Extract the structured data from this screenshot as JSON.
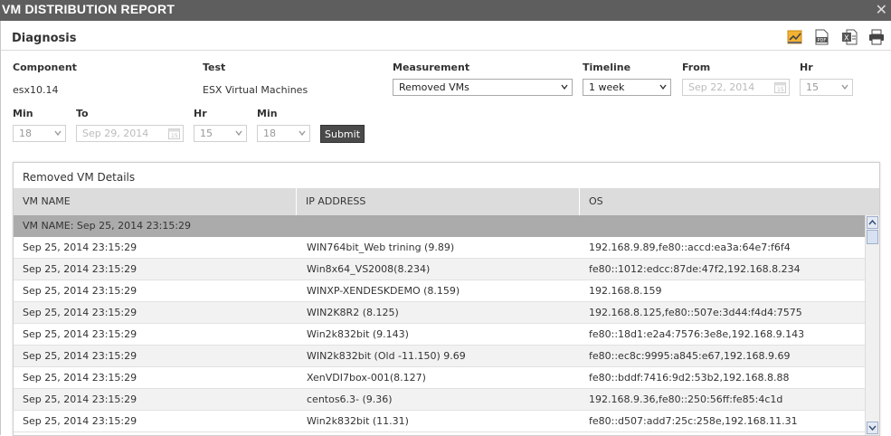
{
  "window": {
    "title": "VM DISTRIBUTION REPORT",
    "close_icon": "close-icon"
  },
  "panel": {
    "heading": "Diagnosis",
    "toolbar": [
      "chart-icon",
      "pdf-icon",
      "excel-icon",
      "print-icon"
    ]
  },
  "form": {
    "component_label": "Component",
    "component_value": "esx10.14",
    "test_label": "Test",
    "test_value": "ESX Virtual Machines",
    "measurement_label": "Measurement",
    "measurement_value": "Removed VMs",
    "timeline_label": "Timeline",
    "timeline_value": "1 week",
    "from_label": "From",
    "from_value": "Sep 22, 2014",
    "hr_label": "Hr",
    "from_hr": "15",
    "min_label": "Min",
    "from_min": "18",
    "to_label": "To",
    "to_value": "Sep 29, 2014",
    "to_hr_label": "Hr",
    "to_hr": "15",
    "to_min_label": "Min",
    "to_min": "18",
    "submit_label": "Submit"
  },
  "grid": {
    "title": "Removed VM Details",
    "columns": [
      "VM NAME",
      "IP ADDRESS",
      "OS"
    ],
    "group_label": "VM NAME: Sep 25, 2014 23:15:29",
    "rows": [
      [
        "Sep 25, 2014 23:15:29",
        "WIN764bit_Web trining (9.89)",
        "192.168.9.89,fe80::accd:ea3a:64e7:f6f4"
      ],
      [
        "Sep 25, 2014 23:15:29",
        "Win8x64_VS2008(8.234)",
        "fe80::1012:edcc:87de:47f2,192.168.8.234"
      ],
      [
        "Sep 25, 2014 23:15:29",
        "WINXP-XENDESKDEMO (8.159)",
        "192.168.8.159"
      ],
      [
        "Sep 25, 2014 23:15:29",
        "WIN2K8R2 (8.125)",
        "192.168.8.125,fe80::507e:3d44:f4d4:7575"
      ],
      [
        "Sep 25, 2014 23:15:29",
        "Win2k832bit (9.143)",
        "fe80::18d1:e2a4:7576:3e8e,192.168.9.143"
      ],
      [
        "Sep 25, 2014 23:15:29",
        "WIN2k832bit (Old -11.150) 9.69",
        "fe80::ec8c:9995:a845:e67,192.168.9.69"
      ],
      [
        "Sep 25, 2014 23:15:29",
        "XenVDI7box-001(8.127)",
        "fe80::bddf:7416:9d2:53b2,192.168.8.88"
      ],
      [
        "Sep 25, 2014 23:15:29",
        "centos6.3- (9.36)",
        "192.168.9.36,fe80::250:56ff:fe85:4c1d"
      ],
      [
        "Sep 25, 2014 23:15:29",
        "Win2k832bit (11.31)",
        "fe80::d507:add7:25c:258e,192.168.11.31"
      ]
    ]
  },
  "colors": {
    "titlebar": "#5e5e5e",
    "header_row": "#dcdcdc",
    "group_row": "#ababab",
    "submit": "#4a4a4a"
  }
}
